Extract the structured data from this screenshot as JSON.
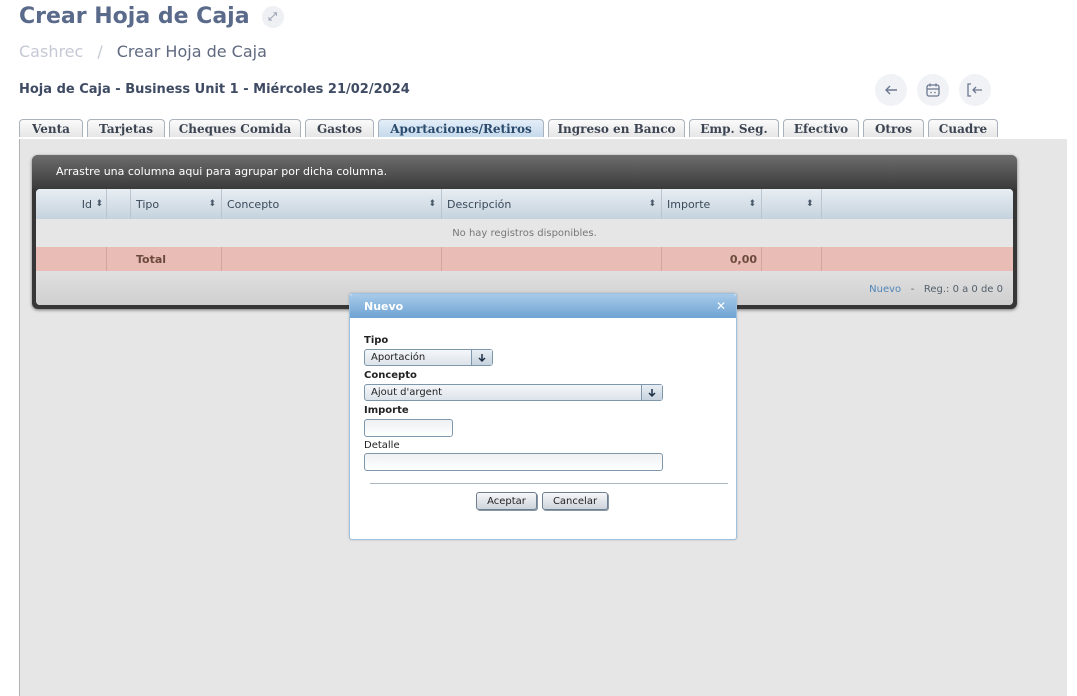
{
  "page": {
    "title": "Crear Hoja de Caja",
    "breadcrumb_root": "Cashrec",
    "breadcrumb_sep": "/",
    "breadcrumb_current": "Crear Hoja de Caja",
    "subheader": "Hoja de Caja - Business Unit 1 - Miércoles 21/02/2024"
  },
  "icons": {
    "back": "←",
    "expand": "⤢",
    "exit": "[←"
  },
  "tabs": [
    {
      "label": "Venta",
      "active": false
    },
    {
      "label": "Tarjetas",
      "active": false
    },
    {
      "label": "Cheques Comida",
      "active": false
    },
    {
      "label": "Gastos",
      "active": false
    },
    {
      "label": "Aportaciones/Retiros",
      "active": true
    },
    {
      "label": "Ingreso en Banco",
      "active": false
    },
    {
      "label": "Emp. Seg.",
      "active": false
    },
    {
      "label": "Efectivo",
      "active": false
    },
    {
      "label": "Otros",
      "active": false
    },
    {
      "label": "Cuadre",
      "active": false
    }
  ],
  "grid": {
    "group_hint": "Arrastre una columna aqui para agrupar por dicha columna.",
    "columns": [
      "Id",
      "",
      "Tipo",
      "Concepto",
      "Descripción",
      "Importe",
      ""
    ],
    "empty_text": "No hay registros disponibles.",
    "total_label": "Total",
    "total_value": "0,00",
    "pager_new": "Nuevo",
    "pager_dash": "-",
    "pager_info": "Reg.: 0 a 0 de 0"
  },
  "dialog": {
    "title": "Nuevo",
    "close": "✕",
    "tipo_label": "Tipo",
    "tipo_value": "Aportación",
    "concepto_label": "Concepto",
    "concepto_value": "Ajout d'argent",
    "importe_label": "Importe",
    "importe_value": "",
    "detalle_label": "Detalle",
    "detalle_value": "",
    "dropdown_arrow": "🡇",
    "accept": "Aceptar",
    "cancel": "Cancelar"
  }
}
